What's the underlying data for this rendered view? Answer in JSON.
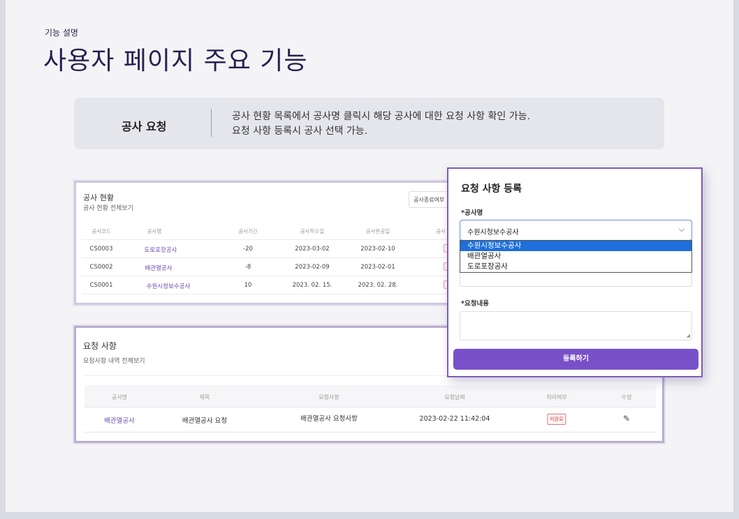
{
  "header": {
    "eyebrow": "기능 설명",
    "title": "사용자 페이지 주요 기능"
  },
  "summary": {
    "label": "공사 요청",
    "desc_line1": "공사 현황 목록에서 공사명 클릭시 해당 공사에 대한 요청 사항 확인 가능.",
    "desc_line2": "요청 사항 등록시 공사 선택 가능."
  },
  "status_panel": {
    "title": "공사 현황",
    "subtitle": "공사 현황 전체보기",
    "filter_label": "공사종료여부",
    "columns": [
      "공사코드",
      "공사명",
      "공사기간",
      "공사착수일",
      "공사완공일",
      "공사"
    ],
    "rows": [
      {
        "code": "CS0003",
        "name": "도로포장공사",
        "period": "-20",
        "start": "2023-03-02",
        "end": "2023-02-10"
      },
      {
        "code": "CS0002",
        "name": "배관열공사",
        "period": "-8",
        "start": "2023-02-09",
        "end": "2023-02-01"
      },
      {
        "code": "CS0001",
        "name": "수원시청보수공사",
        "period": "10",
        "start": "2023. 02. 15.",
        "end": "2023. 02. 28."
      }
    ]
  },
  "request_panel": {
    "title": "요청 사항",
    "subtitle": "요청사항 내역 전체보기",
    "columns": [
      "공사명",
      "제목",
      "요청사항",
      "요청날짜",
      "처리여부",
      "수정"
    ],
    "rows": [
      {
        "project": "배관열공사",
        "subject": "배관열공사 요청",
        "content": "배관열공사 요청사항",
        "date": "2023-02-22 11:42:04",
        "status": "미완료"
      }
    ]
  },
  "modal": {
    "title": "요청 사항 등록",
    "project_label": "*공사명",
    "selected_value": "수원시청보수공사",
    "options": [
      "수원시청보수공사",
      "배관열공사",
      "도로포장공사"
    ],
    "content_label": "*요청내용",
    "submit_label": "등록하기"
  }
}
